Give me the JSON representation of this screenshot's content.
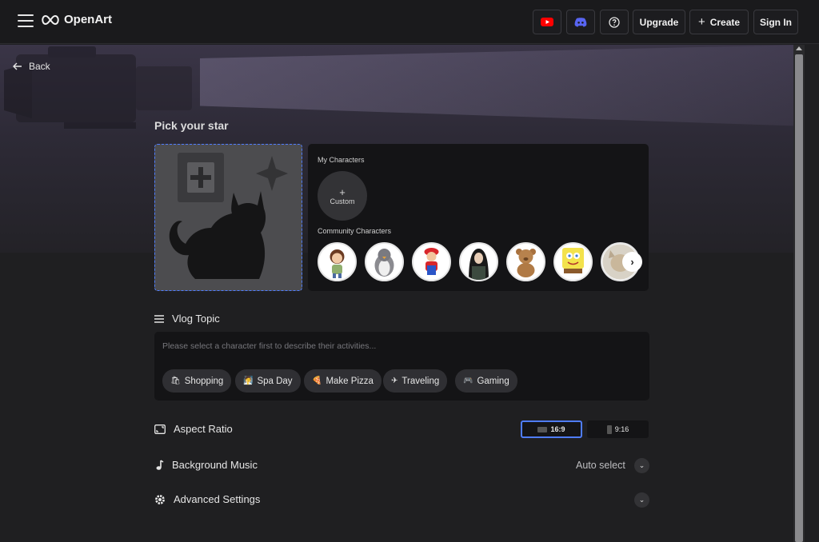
{
  "header": {
    "brand": "OpenArt",
    "upgrade_label": "Upgrade",
    "create_label": "Create",
    "signin_label": "Sign In"
  },
  "nav": {
    "back_label": "Back"
  },
  "pick": {
    "title": "Pick your star",
    "my_characters_label": "My Characters",
    "custom_label": "Custom",
    "community_label": "Community Characters"
  },
  "vlog": {
    "title": "Vlog Topic",
    "placeholder": "Please select a character first to describe their activities...",
    "chips": [
      {
        "label": "Shopping",
        "icon": "shopping-bag-icon"
      },
      {
        "label": "Spa Day",
        "icon": "spa-icon"
      },
      {
        "label": "Make Pizza",
        "icon": "pizza-icon"
      },
      {
        "label": "Traveling",
        "icon": "airplane-icon"
      },
      {
        "label": "Gaming",
        "icon": "gamepad-icon"
      }
    ]
  },
  "aspect": {
    "title": "Aspect Ratio",
    "options": [
      "16:9",
      "9:16"
    ],
    "selected": "16:9"
  },
  "music": {
    "title": "Background Music",
    "value": "Auto select"
  },
  "advanced": {
    "title": "Advanced Settings"
  },
  "colors": {
    "accent": "#4f7dff",
    "youtube": "#ff0000",
    "discord": "#5865f2"
  }
}
